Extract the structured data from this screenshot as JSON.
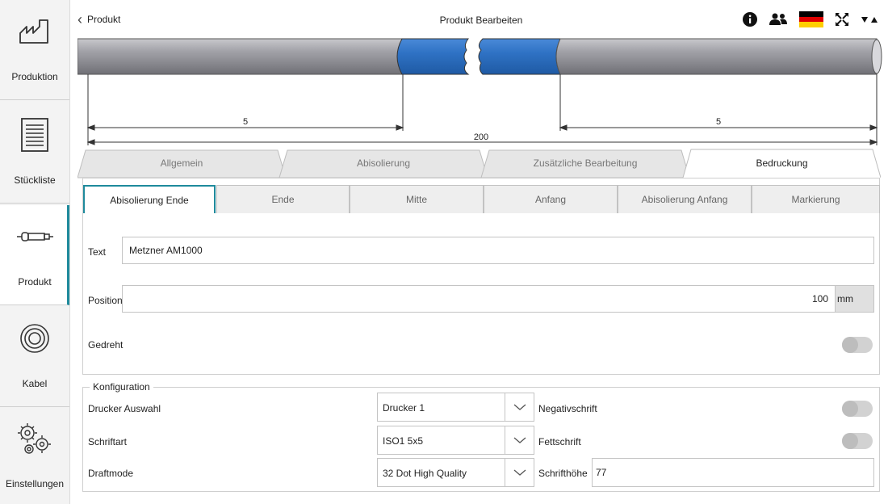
{
  "sidebar": {
    "items": [
      {
        "label": "Produktion",
        "icon": "factory-icon",
        "active": false
      },
      {
        "label": "Stückliste",
        "icon": "document-list-icon",
        "active": false
      },
      {
        "label": "Produkt",
        "icon": "cable-product-icon",
        "active": true
      },
      {
        "label": "Kabel",
        "icon": "cable-coil-icon",
        "active": false
      },
      {
        "label": "Einstellungen",
        "icon": "gears-icon",
        "active": false
      }
    ]
  },
  "header": {
    "back_label": "Produkt",
    "title": "Produkt Bearbeiten",
    "icons": [
      "info-icon",
      "users-icon",
      "german-flag-icon",
      "fullscreen-icon",
      "sort-toggle-icon"
    ]
  },
  "diagram": {
    "left_strip_length": "5",
    "right_strip_length": "5",
    "total_length": "200"
  },
  "main_tabs": [
    {
      "label": "Allgemein",
      "active": false
    },
    {
      "label": "Abisolierung",
      "active": false
    },
    {
      "label": "Zusätzliche Bearbeitung",
      "active": false
    },
    {
      "label": "Bedruckung",
      "active": true
    }
  ],
  "sub_tabs": [
    {
      "label": "Abisolierung Ende",
      "active": true
    },
    {
      "label": "Ende",
      "active": false
    },
    {
      "label": "Mitte",
      "active": false
    },
    {
      "label": "Anfang",
      "active": false
    },
    {
      "label": "Abisolierung Anfang",
      "active": false
    },
    {
      "label": "Markierung",
      "active": false
    }
  ],
  "print": {
    "text_label": "Text",
    "text_value": "Metzner AM1000",
    "position_label": "Position",
    "position_value": "100",
    "position_unit": "mm",
    "gedreht_label": "Gedreht",
    "gedreht_on": false
  },
  "config": {
    "legend": "Konfiguration",
    "drucker_label": "Drucker Auswahl",
    "drucker_value": "Drucker 1",
    "schriftart_label": "Schriftart",
    "schriftart_value": "ISO1 5x5",
    "draftmode_label": "Draftmode",
    "draftmode_value": "32 Dot High Quality",
    "negativ_label": "Negativschrift",
    "negativ_on": false,
    "fett_label": "Fettschrift",
    "fett_on": false,
    "hoehe_label": "Schrifthöhe",
    "hoehe_value": "77"
  },
  "colors": {
    "accent": "#1f8a9c",
    "cable_gray": "#8e8e96",
    "strip_blue": "#2f72c4"
  }
}
